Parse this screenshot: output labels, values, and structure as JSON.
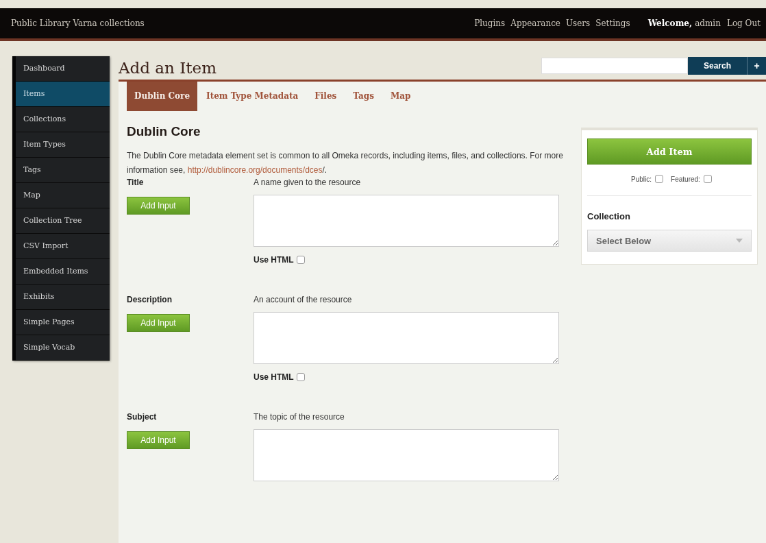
{
  "top_bar": {
    "site_title": "Public Library Varna collections",
    "links": [
      "Plugins",
      "Appearance",
      "Users",
      "Settings"
    ],
    "welcome": "Welcome,",
    "user": "admin",
    "logout": "Log Out"
  },
  "sidebar": {
    "items": [
      {
        "label": "Dashboard",
        "selected": false
      },
      {
        "label": "Items",
        "selected": true
      },
      {
        "label": "Collections",
        "selected": false
      },
      {
        "label": "Item Types",
        "selected": false
      },
      {
        "label": "Tags",
        "selected": false
      },
      {
        "label": "Map",
        "selected": false
      },
      {
        "label": "Collection Tree",
        "selected": false
      },
      {
        "label": "CSV Import",
        "selected": false
      },
      {
        "label": "Embedded Items",
        "selected": false
      },
      {
        "label": "Exhibits",
        "selected": false
      },
      {
        "label": "Simple Pages",
        "selected": false
      },
      {
        "label": "Simple Vocab",
        "selected": false
      }
    ]
  },
  "page_title": "Add an Item",
  "search": {
    "button": "Search",
    "add": "+"
  },
  "tabs": [
    {
      "label": "Dublin Core",
      "selected": true
    },
    {
      "label": "Item Type Metadata",
      "selected": false
    },
    {
      "label": "Files",
      "selected": false
    },
    {
      "label": "Tags",
      "selected": false
    },
    {
      "label": "Map",
      "selected": false
    }
  ],
  "section": {
    "heading": "Dublin Core",
    "text_before": "The Dublin Core metadata element set is common to all Omeka records, including items, files, and collections. For more information see, ",
    "link": "http://dublincore.org/documents/dces",
    "text_after": "/."
  },
  "fields": [
    {
      "label": "Title",
      "add_button": "Add Input",
      "hint": "A name given to the resource",
      "use_html": {
        "label": "Use HTML",
        "checked": false
      }
    },
    {
      "label": "Description",
      "add_button": "Add Input",
      "hint": "An account of the resource",
      "use_html": {
        "label": "Use HTML",
        "checked": false
      }
    },
    {
      "label": "Subject",
      "add_button": "Add Input",
      "hint": "The topic of the resource"
    }
  ],
  "side_panel": {
    "add_item": "Add Item",
    "public": {
      "label": "Public:",
      "checked": false
    },
    "featured": {
      "label": "Featured:",
      "checked": false
    },
    "collection_label": "Collection",
    "collection_select": "Select Below"
  }
}
